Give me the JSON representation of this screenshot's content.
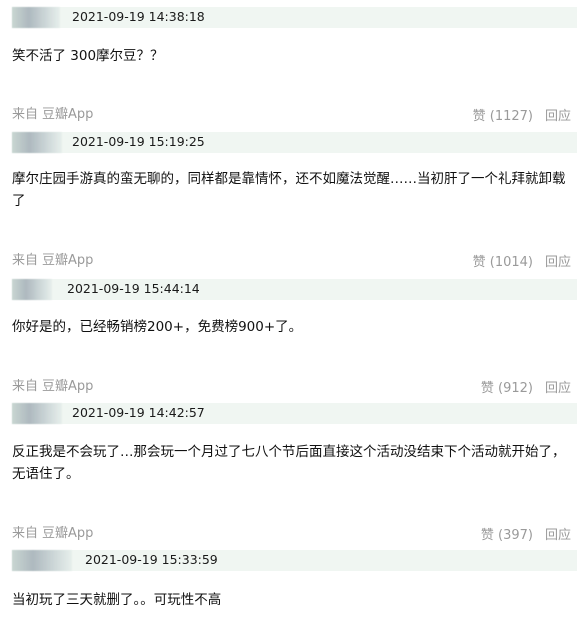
{
  "comments": [
    {
      "time": "2021-09-19 14:38:18",
      "text": "笑不活了 300摩尔豆？？",
      "source_prefix": "来自",
      "source_app": "豆瓣App",
      "likes": "赞 (1127)",
      "reply": "回应"
    },
    {
      "time": "2021-09-19 15:19:25",
      "text": "摩尔庄园手游真的蛮无聊的，同样都是靠情怀，还不如魔法觉醒……当初肝了一个礼拜就卸载了",
      "source_prefix": "来自",
      "source_app": "豆瓣App",
      "likes": "赞 (1014)",
      "reply": "回应"
    },
    {
      "time": "2021-09-19 15:44:14",
      "text": "你好是的，已经畅销榜200+，免费榜900+了。",
      "source_prefix": "来自",
      "source_app": "豆瓣App",
      "likes": "赞 (912)",
      "reply": "回应"
    },
    {
      "time": "2021-09-19 14:42:57",
      "text": "反正我是不会玩了…那会玩一个月过了七八个节后面直接这个活动没结束下个活动就开始了，无语住了。",
      "source_prefix": "来自",
      "source_app": "豆瓣App",
      "likes": "赞 (397)",
      "reply": "回应"
    },
    {
      "time": "2021-09-19 15:33:59",
      "text": "当初玩了三天就删了。。可玩性不高"
    }
  ]
}
